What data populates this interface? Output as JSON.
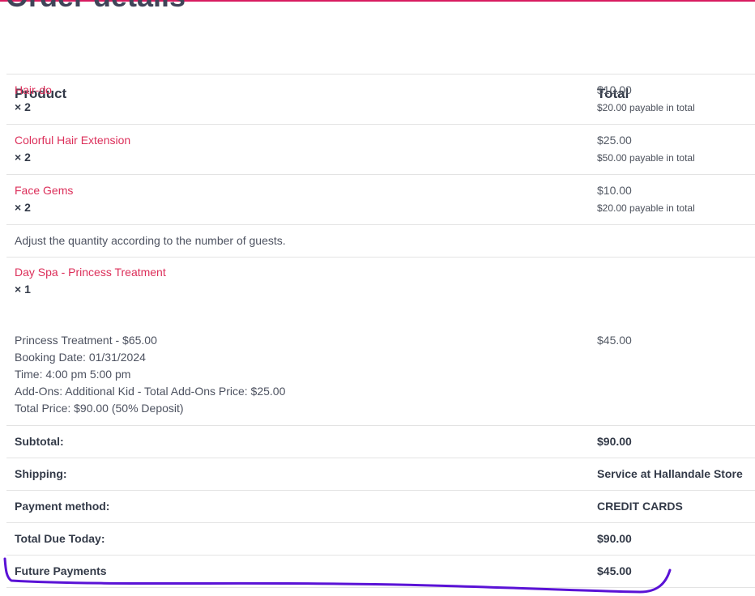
{
  "page": {
    "title": "Order details"
  },
  "table": {
    "headers": {
      "product": "Product",
      "total": "Total"
    },
    "items": [
      {
        "name": "Hair-do",
        "qty": "× 2",
        "price": "$10.00",
        "payable": "$20.00 payable in total"
      },
      {
        "name": "Colorful Hair Extension",
        "qty": "× 2",
        "price": "$25.00",
        "payable": "$50.00 payable in total"
      },
      {
        "name": "Face Gems",
        "qty": "× 2",
        "price": "$10.00",
        "payable": "$20.00 payable in total"
      }
    ],
    "note": "Adjust the quantity according to the number of guests.",
    "booking": {
      "name": "Day Spa - Princess Treatment",
      "qty": "× 1",
      "details": [
        "Princess Treatment - $65.00",
        "Booking Date: 01/31/2024",
        "Time: 4:00 pm 5:00 pm",
        "Add-Ons: Additional Kid - Total Add-Ons Price: $25.00",
        "Total Price: $90.00 (50% Deposit)"
      ],
      "price": "$45.00"
    },
    "totals": [
      {
        "label": "Subtotal:",
        "value": "$90.00"
      },
      {
        "label": "Shipping:",
        "value": "Service at Hallandale Store"
      },
      {
        "label": "Payment method:",
        "value": "CREDIT CARDS"
      },
      {
        "label": "Total Due Today:",
        "value": "$90.00"
      },
      {
        "label": "Future Payments",
        "value": "$45.00"
      }
    ]
  },
  "colors": {
    "accent_line": "#d81b60",
    "product_link": "#dc2f5a",
    "annotation_stroke": "#5a12d6"
  }
}
